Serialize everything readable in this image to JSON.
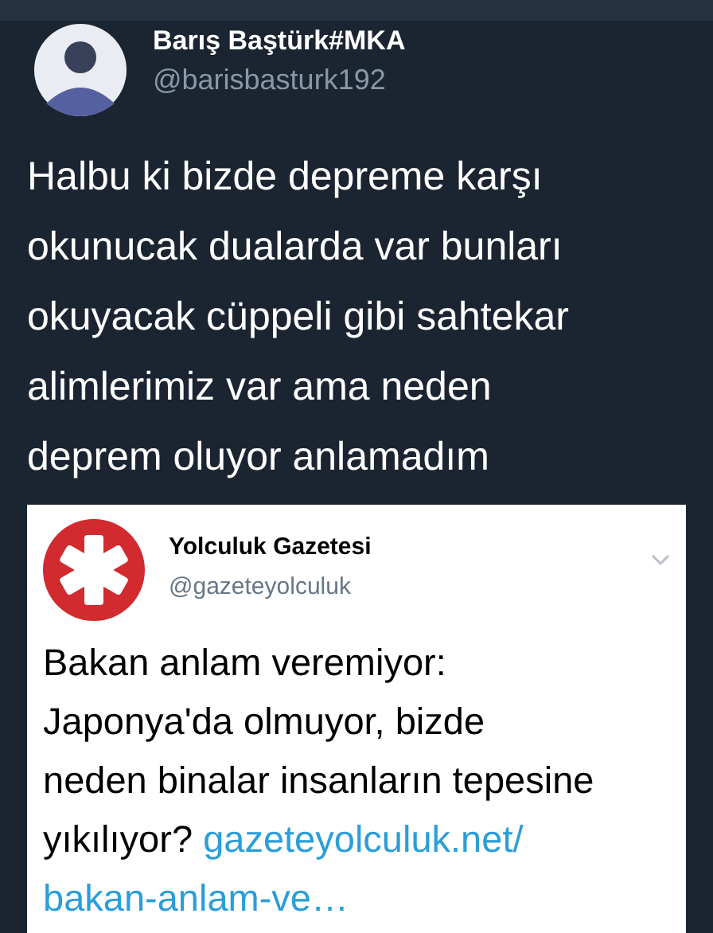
{
  "author": {
    "name": "Barış Baştürk#MKA",
    "handle": "@barisbasturk192"
  },
  "tweet": {
    "lines": [
      "Halbu ki bizde depreme karşı",
      "okunucak dualarda var bunları",
      "okuyacak cüppeli gibi sahtekar",
      "alimlerimiz var ama neden",
      "deprem oluyor anlamadım"
    ]
  },
  "quoted": {
    "name": "Yolculuk Gazetesi",
    "handle": "@gazeteyolculuk",
    "lines": [
      "Bakan anlam veremiyor:",
      "Japonya'da olmuyor, bizde",
      "neden binalar insanların tepesine",
      "yıkılıyor?"
    ],
    "link_lines": [
      "gazeteyolculuk.net/",
      "bakan-anlam-ve…"
    ]
  }
}
